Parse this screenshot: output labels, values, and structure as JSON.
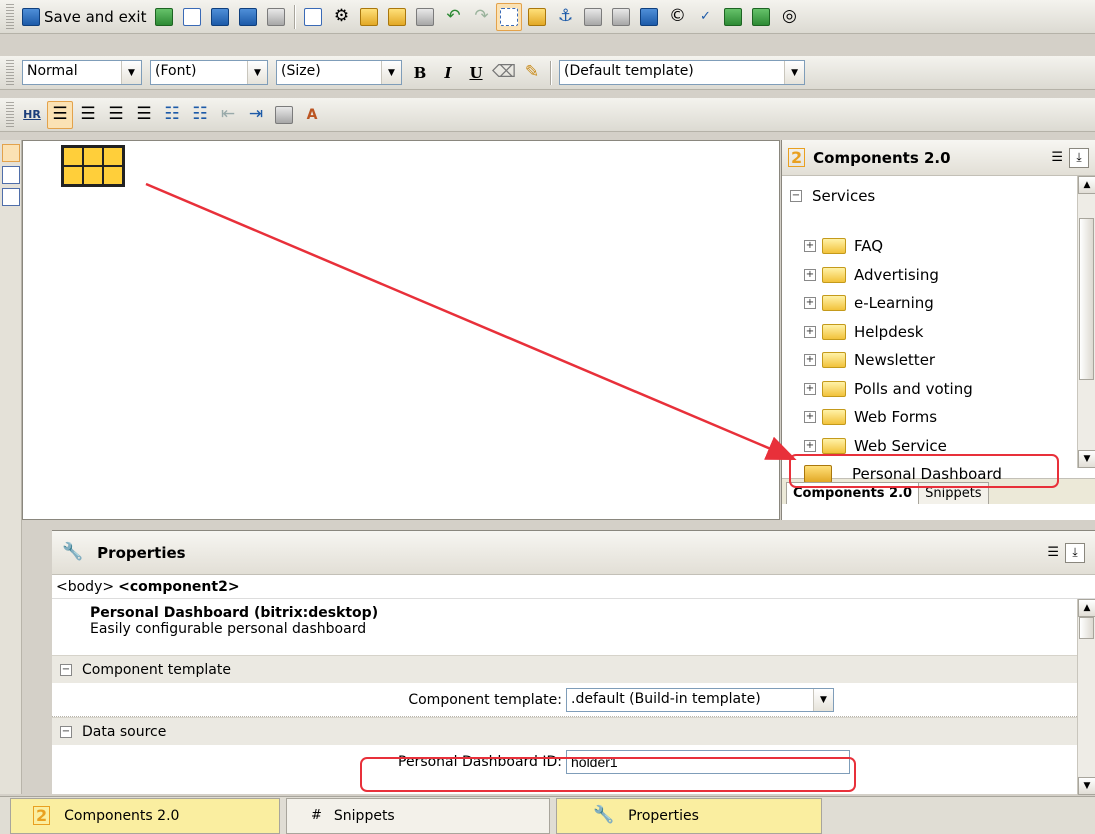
{
  "toolbar1": {
    "save_exit_label": "Save and exit"
  },
  "toolbar2": {
    "style_value": "Normal",
    "font_value": "(Font)",
    "size_value": "(Size)",
    "template_value": "(Default template)",
    "bold": "B",
    "italic": "I",
    "underline": "U"
  },
  "toolbar3": {
    "hr_label": "HR"
  },
  "components_panel": {
    "title": "Components 2.0",
    "root": "Services",
    "items": [
      {
        "label": "FAQ"
      },
      {
        "label": "Advertising"
      },
      {
        "label": "e-Learning"
      },
      {
        "label": "Helpdesk"
      },
      {
        "label": "Newsletter"
      },
      {
        "label": "Polls and voting"
      },
      {
        "label": "Web Forms"
      },
      {
        "label": "Web Service"
      }
    ],
    "selected_item": "Personal Dashboard",
    "tabs": [
      "Components 2.0",
      "Snippets"
    ]
  },
  "properties_panel": {
    "title": "Properties",
    "breadcrumb_body": "<body>",
    "breadcrumb_component": "<component2>",
    "component_title": "Personal Dashboard (bitrix:desktop)",
    "component_desc": "Easily configurable personal dashboard",
    "group_template": "Component template",
    "template_label": "Component template:",
    "template_value": ".default (Build-in template)",
    "group_data": "Data source",
    "dashboard_id_label": "Personal Dashboard ID:",
    "dashboard_id_value": "holder1"
  },
  "bottom_tabs": {
    "components": "Components 2.0",
    "snippets": "Snippets",
    "properties": "Properties"
  },
  "colors": {
    "annotation": "#e8303a",
    "highlight": "#faeea0",
    "accent": "#e9a020"
  }
}
